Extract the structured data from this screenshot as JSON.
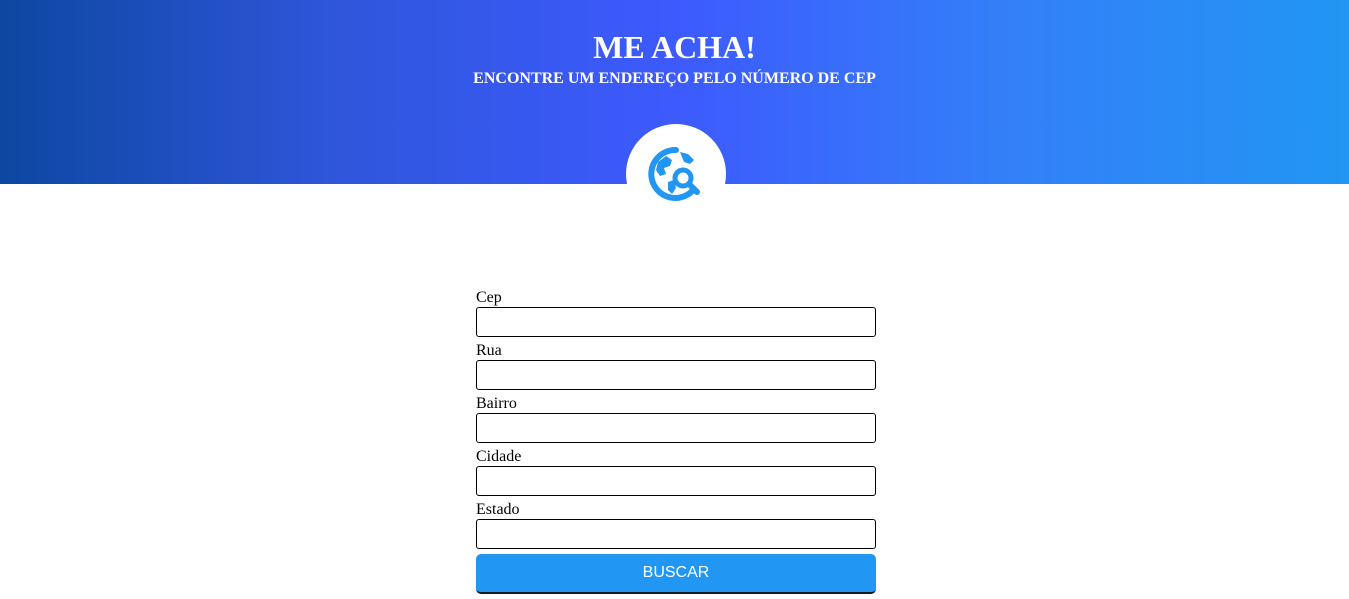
{
  "header": {
    "title": "ME ACHA!",
    "subtitle": "ENCONTRE UM ENDEREÇO PELO NÚMERO DE CEP",
    "gradient_colors": [
      "#0d47a1",
      "#3d5afe",
      "#2196f3"
    ],
    "logo_icon": "globe-search-icon",
    "logo_color": "#2196f3"
  },
  "form": {
    "fields": [
      {
        "label": "Cep",
        "value": ""
      },
      {
        "label": "Rua",
        "value": ""
      },
      {
        "label": "Bairro",
        "value": ""
      },
      {
        "label": "Cidade",
        "value": ""
      },
      {
        "label": "Estado",
        "value": ""
      }
    ],
    "submit_label": "BUSCAR",
    "submit_color": "#2196f3"
  }
}
